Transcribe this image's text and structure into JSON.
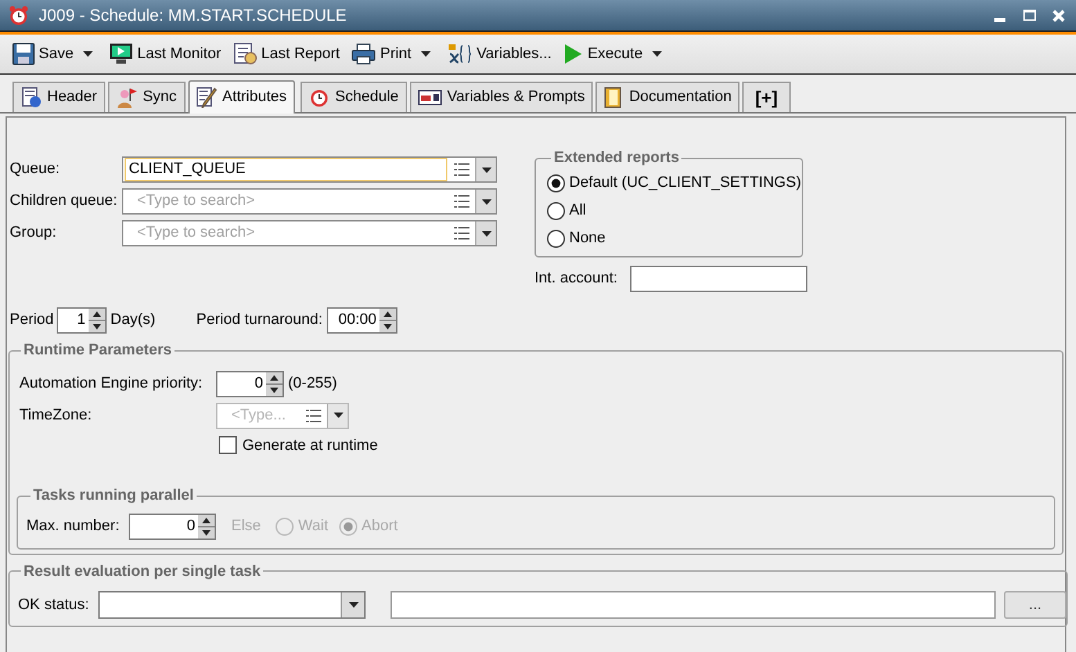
{
  "window": {
    "title": "J009 - Schedule: MM.START.SCHEDULE"
  },
  "toolbar": [
    {
      "label": "Save",
      "dropdown": true
    },
    {
      "label": "Last Monitor",
      "dropdown": false
    },
    {
      "label": "Last Report",
      "dropdown": false
    },
    {
      "label": "Print",
      "dropdown": true
    },
    {
      "label": "Variables...",
      "dropdown": false
    },
    {
      "label": "Execute",
      "dropdown": true
    }
  ],
  "tabs": [
    {
      "label": "Header",
      "selected": false,
      "kind": "page"
    },
    {
      "label": "Sync",
      "selected": false,
      "kind": "page"
    },
    {
      "label": "Attributes",
      "selected": true,
      "kind": "page"
    },
    {
      "label": "Schedule",
      "selected": false,
      "kind": "page"
    },
    {
      "label": "Variables & Prompts",
      "selected": false,
      "kind": "page"
    },
    {
      "label": "Documentation",
      "selected": false,
      "kind": "page"
    },
    {
      "label": "[+]",
      "selected": false,
      "kind": "add"
    }
  ],
  "queue": {
    "label": "Queue:",
    "value": "CLIENT_QUEUE",
    "focused": true
  },
  "children_queue": {
    "label": "Children queue:",
    "placeholder": "<Type to search>",
    "focused": false
  },
  "group": {
    "label": "Group:",
    "placeholder": "<Type to search>",
    "focused": false
  },
  "extended_reports": {
    "title": "Extended reports",
    "options": [
      {
        "label": "Default (UC_CLIENT_SETTINGS)",
        "selected": true
      },
      {
        "label": "All",
        "selected": false
      },
      {
        "label": "None",
        "selected": false
      }
    ]
  },
  "int_account": {
    "label": "Int. account:"
  },
  "period": {
    "label": "Period",
    "value": "1",
    "unit": "Day(s)"
  },
  "period_turnaround": {
    "label": "Period turnaround:",
    "value": "00:00"
  },
  "runtime_parameters": {
    "title": "Runtime Parameters",
    "priority": {
      "label": "Automation Engine priority:",
      "value": "0",
      "range": "(0-255)"
    },
    "timezone": {
      "label": "TimeZone:",
      "placeholder": "<Type...",
      "disabled": true
    },
    "generate_at_runtime": {
      "label": "Generate at runtime",
      "checked": false
    },
    "tasks_running_parallel": {
      "title": "Tasks running parallel",
      "max_label": "Max. number:",
      "max_value": "0",
      "else_label": "Else",
      "disabled": true,
      "options": [
        {
          "label": "Wait",
          "selected": false
        },
        {
          "label": "Abort",
          "selected": true
        }
      ]
    }
  },
  "result_evaluation": {
    "title": "Result evaluation per single task",
    "ok_label": "OK status:",
    "browse": "..."
  }
}
